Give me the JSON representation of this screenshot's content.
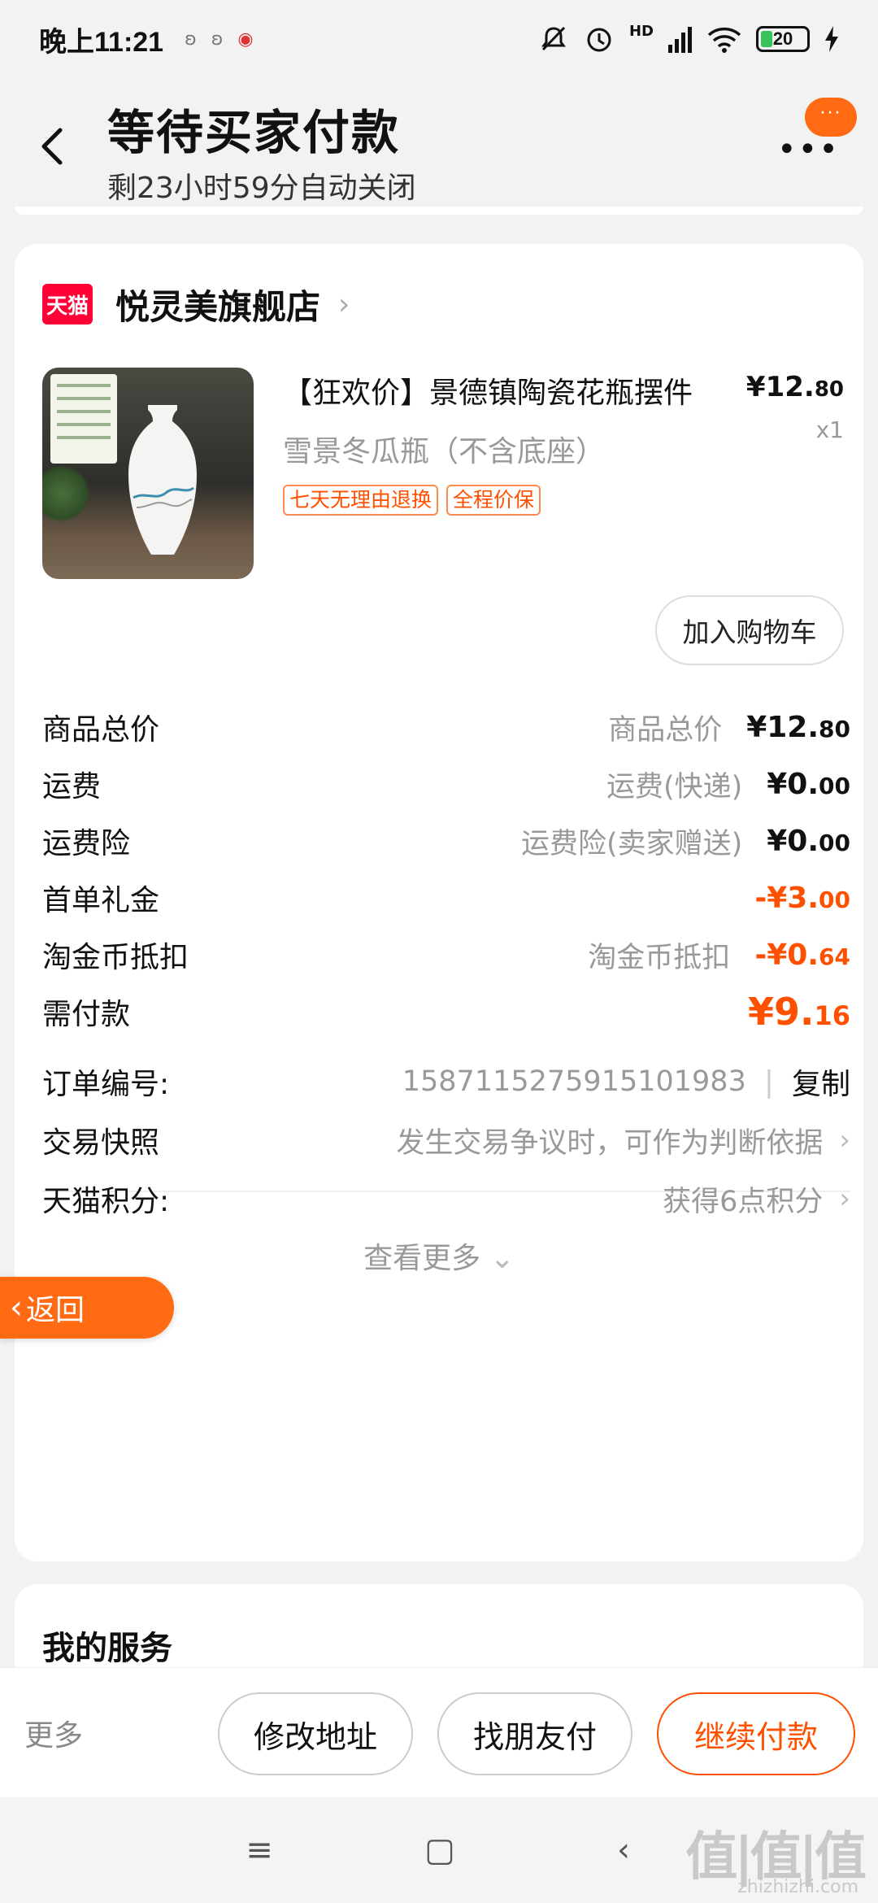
{
  "status_bar": {
    "time": "晚上11:21",
    "notif_icons": [
      "notification-icon",
      "notification-icon",
      "notification-icon"
    ],
    "battery": "20",
    "network": "HD"
  },
  "header": {
    "title": "等待买家付款",
    "subtitle": "剩23小时59分自动关闭",
    "bubble_text": "···"
  },
  "shop": {
    "logo_text": "天猫",
    "name": "悦灵美旗舰店"
  },
  "product": {
    "title": "【狂欢价】景德镇陶瓷花瓶摆件",
    "spec": "雪景冬瓜瓶（不含底座）",
    "price_main": "¥12.",
    "price_cents": "80",
    "qty": "x1",
    "tags": [
      "七天无理由退换",
      "全程价保"
    ],
    "add_cart": "加入购物车"
  },
  "fees": [
    {
      "label": "商品总价",
      "desc": "商品总价",
      "amount_main": "¥12.",
      "amount_cents": "80",
      "orange": false
    },
    {
      "label": "运费",
      "desc": "运费(快递)",
      "amount_main": "¥0.",
      "amount_cents": "00",
      "orange": false
    },
    {
      "label": "运费险",
      "desc": "运费险(卖家赠送)",
      "amount_main": "¥0.",
      "amount_cents": "00",
      "orange": false
    },
    {
      "label": "首单礼金",
      "desc": "",
      "amount_main": "-¥3.",
      "amount_cents": "00",
      "orange": true
    },
    {
      "label": "淘金币抵扣",
      "desc": "淘金币抵扣",
      "amount_main": "-¥0.",
      "amount_cents": "64",
      "orange": true
    },
    {
      "label": "需付款",
      "desc": "",
      "amount_main": "¥9.",
      "amount_cents": "16",
      "orange": true
    }
  ],
  "order_info": {
    "order_label": "订单编号:",
    "order_number": "1587115275915101983",
    "separator": "|",
    "copy": "复制",
    "snapshot_label": "交易快照",
    "snapshot_desc": "发生交易争议时，可作为判断依据",
    "points_label": "天猫积分:",
    "points_desc": "获得6点积分",
    "see_more": "查看更多"
  },
  "back_float": "返回",
  "services": {
    "title": "我的服务"
  },
  "bottom_bar": {
    "more": "更多",
    "modify_address": "修改地址",
    "friend_pay": "找朋友付",
    "continue_pay": "继续付款"
  },
  "watermark": {
    "main": "值|值|值",
    "sub": "zhizhizhi.com"
  },
  "colors": {
    "accent": "#ff5000",
    "tmall_red": "#ff0036",
    "float_orange": "#ff6a13"
  }
}
